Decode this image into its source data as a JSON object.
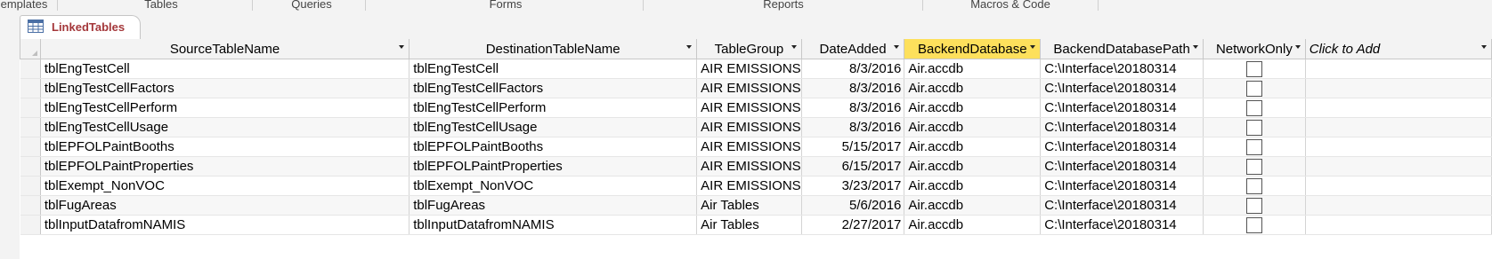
{
  "ribbon": {
    "groups": [
      "emplates",
      "Tables",
      "Queries",
      "Forms",
      "Reports",
      "Macros & Code"
    ]
  },
  "document_tab": {
    "label": "LinkedTables",
    "icon": "table-icon"
  },
  "table": {
    "columns": [
      {
        "label": "SourceTableName",
        "sorted": false
      },
      {
        "label": "DestinationTableName",
        "sorted": false
      },
      {
        "label": "TableGroup",
        "sorted": false
      },
      {
        "label": "DateAdded",
        "sorted": false
      },
      {
        "label": "BackendDatabase",
        "sorted": true
      },
      {
        "label": "BackendDatabasePath",
        "sorted": false
      },
      {
        "label": "NetworkOnly",
        "sorted": false
      },
      {
        "label": "Click to Add",
        "sorted": false
      }
    ],
    "rows": [
      [
        "tblEngTestCell",
        "tblEngTestCell",
        "AIR EMISSIONS",
        "8/3/2016",
        "Air.accdb",
        "C:\\Interface\\20180314"
      ],
      [
        "tblEngTestCellFactors",
        "tblEngTestCellFactors",
        "AIR EMISSIONS",
        "8/3/2016",
        "Air.accdb",
        "C:\\Interface\\20180314"
      ],
      [
        "tblEngTestCellPerform",
        "tblEngTestCellPerform",
        "AIR EMISSIONS",
        "8/3/2016",
        "Air.accdb",
        "C:\\Interface\\20180314"
      ],
      [
        "tblEngTestCellUsage",
        "tblEngTestCellUsage",
        "AIR EMISSIONS",
        "8/3/2016",
        "Air.accdb",
        "C:\\Interface\\20180314"
      ],
      [
        "tblEPFOLPaintBooths",
        "tblEPFOLPaintBooths",
        "AIR EMISSIONS",
        "5/15/2017",
        "Air.accdb",
        "C:\\Interface\\20180314"
      ],
      [
        "tblEPFOLPaintProperties",
        "tblEPFOLPaintProperties",
        "AIR EMISSIONS",
        "6/15/2017",
        "Air.accdb",
        "C:\\Interface\\20180314"
      ],
      [
        "tblExempt_NonVOC",
        "tblExempt_NonVOC",
        "AIR EMISSIONS",
        "3/23/2017",
        "Air.accdb",
        "C:\\Interface\\20180314"
      ],
      [
        "tblFugAreas",
        "tblFugAreas",
        "Air Tables",
        "5/6/2016",
        "Air.accdb",
        "C:\\Interface\\20180314"
      ],
      [
        "tblInputDatafromNAMIS",
        "tblInputDatafromNAMIS",
        "Air Tables",
        "2/27/2017",
        "Air.accdb",
        "C:\\Interface\\20180314"
      ]
    ],
    "network_only": [
      false,
      false,
      false,
      false,
      false,
      false,
      false,
      false,
      false
    ]
  },
  "colors": {
    "tab_label": "#a4373a",
    "sorted_header": "#fde05c",
    "header_bg": "#f3f3f3"
  }
}
